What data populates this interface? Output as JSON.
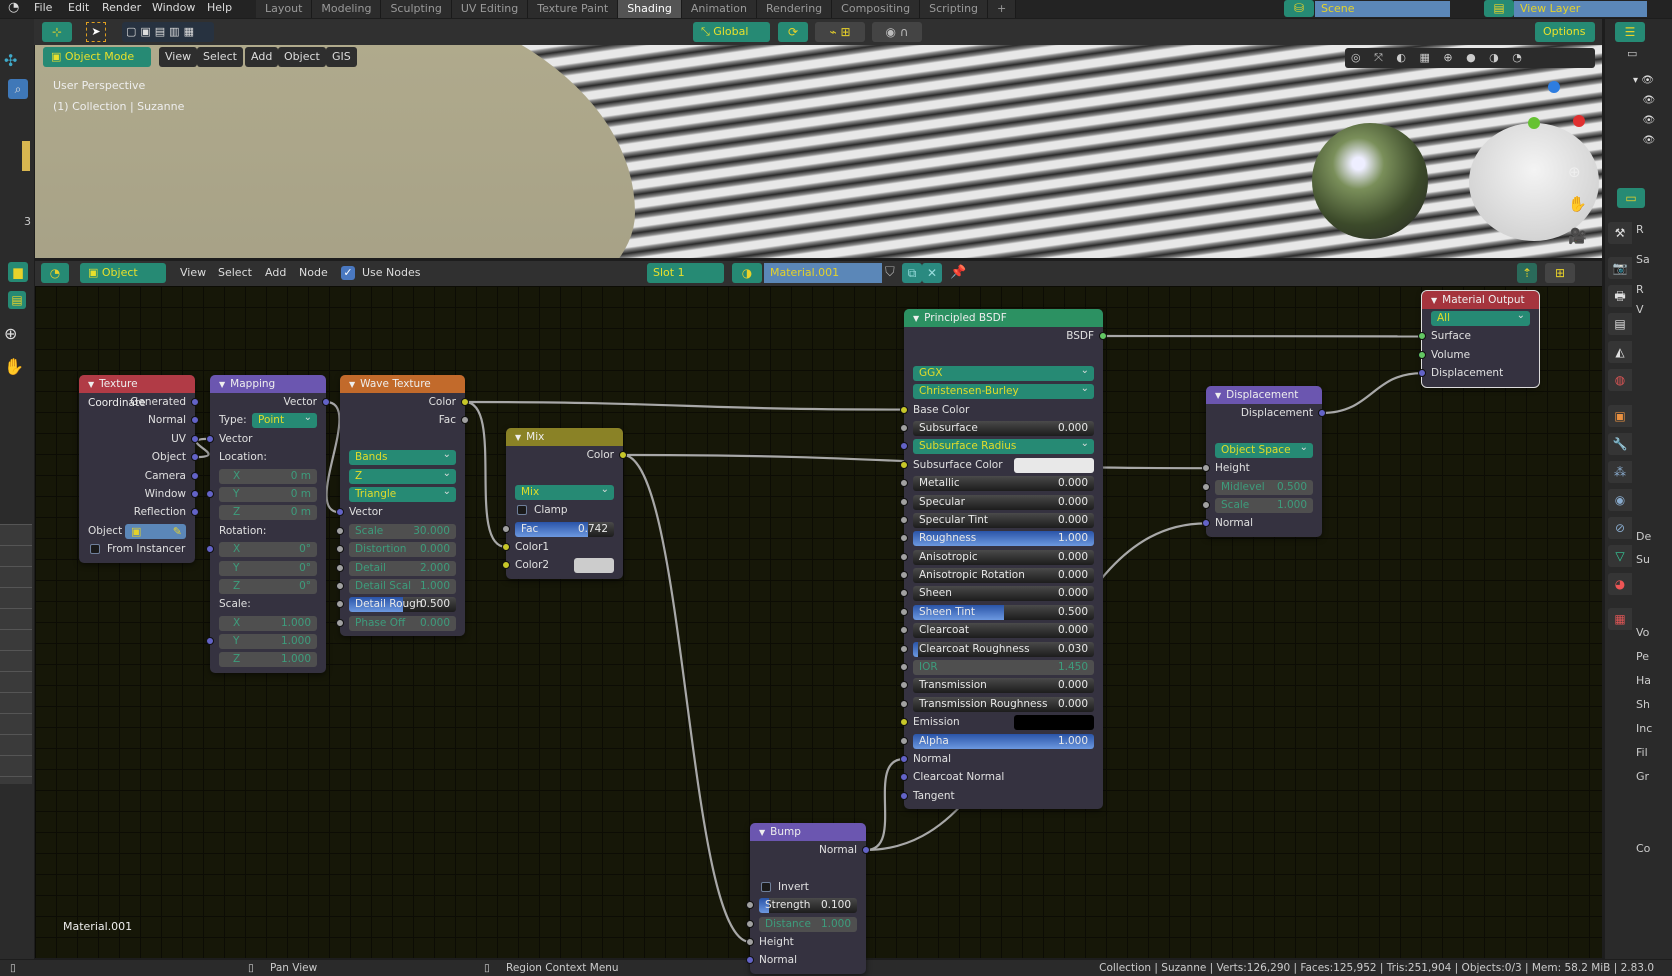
{
  "topbar": {
    "menus": [
      "File",
      "Edit",
      "Render",
      "Window",
      "Help"
    ],
    "tabs": [
      "Layout",
      "Modeling",
      "Sculpting",
      "UV Editing",
      "Texture Paint",
      "Shading",
      "Animation",
      "Rendering",
      "Compositing",
      "Scripting"
    ],
    "active_tab": "Shading",
    "add_tab": "+",
    "scene": "Scene",
    "view_layer": "View Layer"
  },
  "viewport_header": {
    "transform_orientation": "Global",
    "options": "Options",
    "mode": "Object Mode",
    "menus": [
      "View",
      "Select",
      "Add",
      "Object",
      "GIS"
    ]
  },
  "viewport": {
    "perspective": "User Perspective",
    "collection": "(1) Collection | Suzanne",
    "ruler_number": "3"
  },
  "node_header": {
    "object_dropdown": "Object",
    "menus": [
      "View",
      "Select",
      "Add",
      "Node"
    ],
    "use_nodes": "Use Nodes",
    "use_nodes_checked": true,
    "slot": "Slot 1",
    "material": "Material.001"
  },
  "canvas": {
    "material_label": "Material.001"
  },
  "colors": {
    "yellow": "#c7c729",
    "grey": "#a1a1a1",
    "blue": "#6363c7",
    "green": "#63c763",
    "header_texcoord": "#b13b46",
    "header_vector": "#6b56b0",
    "header_texture": "#c26a2b",
    "header_color": "#8a8226",
    "header_shader": "#2c9162",
    "header_output": "#a5343d"
  },
  "nodes": [
    {
      "id": "texcoord",
      "title": "Texture Coordinate",
      "head": "header_texcoord",
      "rows": [
        {
          "t": "out",
          "label": "Generated",
          "s": "blue"
        },
        {
          "t": "out",
          "label": "Normal",
          "s": "blue"
        },
        {
          "t": "out",
          "label": "UV",
          "s": "blue"
        },
        {
          "t": "out",
          "label": "Object",
          "s": "blue"
        },
        {
          "t": "out",
          "label": "Camera",
          "s": "blue"
        },
        {
          "t": "out",
          "label": "Window",
          "s": "blue"
        },
        {
          "t": "out",
          "label": "Reflection",
          "s": "blue"
        },
        {
          "t": "obj",
          "label": "Object"
        },
        {
          "t": "check",
          "label": "From Instancer"
        }
      ]
    },
    {
      "id": "mapping",
      "title": "Mapping",
      "head": "header_vector",
      "rows": [
        {
          "t": "out",
          "label": "Vector",
          "s": "blue"
        },
        {
          "t": "ddl",
          "label": "Type:",
          "value": "Point"
        },
        {
          "t": "in",
          "label": "Vector",
          "s": "blue"
        },
        {
          "t": "text",
          "label": "Location:"
        },
        {
          "t": "dis",
          "label": "X",
          "value": "0 m"
        },
        {
          "t": "dis",
          "label": "Y",
          "value": "0 m",
          "s": "blue"
        },
        {
          "t": "dis",
          "label": "Z",
          "value": "0 m"
        },
        {
          "t": "text",
          "label": "Rotation:"
        },
        {
          "t": "dis",
          "label": "X",
          "value": "0°",
          "s": "blue"
        },
        {
          "t": "dis",
          "label": "Y",
          "value": "0°"
        },
        {
          "t": "dis",
          "label": "Z",
          "value": "0°"
        },
        {
          "t": "text",
          "label": "Scale:"
        },
        {
          "t": "dis",
          "label": "X",
          "value": "1.000"
        },
        {
          "t": "dis",
          "label": "Y",
          "value": "1.000",
          "s": "blue"
        },
        {
          "t": "dis",
          "label": "Z",
          "value": "1.000"
        }
      ]
    },
    {
      "id": "wave",
      "title": "Wave Texture",
      "head": "header_texture",
      "rows": [
        {
          "t": "out",
          "label": "Color",
          "s": "yellow"
        },
        {
          "t": "out",
          "label": "Fac",
          "s": "grey"
        },
        {
          "t": "gap"
        },
        {
          "t": "dd",
          "value": "Bands"
        },
        {
          "t": "dd",
          "value": "Z"
        },
        {
          "t": "dd",
          "value": "Triangle"
        },
        {
          "t": "in",
          "label": "Vector",
          "s": "blue"
        },
        {
          "t": "dis",
          "label": "Scale",
          "value": "30.000",
          "s": "grey"
        },
        {
          "t": "dis",
          "label": "Distortion",
          "value": "0.000",
          "s": "grey"
        },
        {
          "t": "dis",
          "label": "Detail",
          "value": "2.000",
          "s": "grey"
        },
        {
          "t": "dis",
          "label": "Detail Scal",
          "value": "1.000",
          "s": "grey"
        },
        {
          "t": "sl",
          "label": "Detail Rough",
          "value": "0.500",
          "fill": 0.5,
          "s": "grey"
        },
        {
          "t": "dis",
          "label": "Phase Off",
          "value": "0.000",
          "s": "grey"
        }
      ]
    },
    {
      "id": "mix",
      "title": "Mix",
      "head": "header_color",
      "rows": [
        {
          "t": "out",
          "label": "Color",
          "s": "yellow"
        },
        {
          "t": "gap"
        },
        {
          "t": "dd",
          "value": "Mix"
        },
        {
          "t": "check",
          "label": "Clamp"
        },
        {
          "t": "sl",
          "label": "Fac",
          "value": "0.742",
          "fill": 0.742,
          "s": "grey"
        },
        {
          "t": "in",
          "label": "Color1",
          "s": "yellow"
        },
        {
          "t": "col",
          "label": "Color2",
          "swatch": "#cccccc",
          "s": "yellow"
        }
      ]
    },
    {
      "id": "principled",
      "title": "Principled BSDF",
      "head": "header_shader",
      "rows": [
        {
          "t": "out",
          "label": "BSDF",
          "s": "green"
        },
        {
          "t": "gap"
        },
        {
          "t": "dd",
          "value": "GGX"
        },
        {
          "t": "dd",
          "value": "Christensen-Burley"
        },
        {
          "t": "in",
          "label": "Base Color",
          "s": "yellow"
        },
        {
          "t": "sl",
          "label": "Subsurface",
          "value": "0.000",
          "fill": 0,
          "s": "grey"
        },
        {
          "t": "dd",
          "value": "Subsurface Radius",
          "s": "blue"
        },
        {
          "t": "col",
          "label": "Subsurface Color",
          "swatch": "#e8e8e8",
          "s": "yellow"
        },
        {
          "t": "sl",
          "label": "Metallic",
          "value": "0.000",
          "fill": 0,
          "s": "grey"
        },
        {
          "t": "sl",
          "label": "Specular",
          "value": "0.000",
          "fill": 0,
          "s": "grey"
        },
        {
          "t": "sl",
          "label": "Specular Tint",
          "value": "0.000",
          "fill": 0,
          "s": "grey"
        },
        {
          "t": "sl",
          "label": "Roughness",
          "value": "1.000",
          "fill": 1,
          "s": "grey"
        },
        {
          "t": "sl",
          "label": "Anisotropic",
          "value": "0.000",
          "fill": 0,
          "s": "grey"
        },
        {
          "t": "sl",
          "label": "Anisotropic Rotation",
          "value": "0.000",
          "fill": 0,
          "s": "grey"
        },
        {
          "t": "sl",
          "label": "Sheen",
          "value": "0.000",
          "fill": 0,
          "s": "grey"
        },
        {
          "t": "sl",
          "label": "Sheen Tint",
          "value": "0.500",
          "fill": 0.5,
          "s": "grey"
        },
        {
          "t": "sl",
          "label": "Clearcoat",
          "value": "0.000",
          "fill": 0,
          "s": "grey"
        },
        {
          "t": "sl",
          "label": "Clearcoat Roughness",
          "value": "0.030",
          "fill": 0.03,
          "s": "grey"
        },
        {
          "t": "dis",
          "label": "IOR",
          "value": "1.450",
          "s": "grey"
        },
        {
          "t": "sl",
          "label": "Transmission",
          "value": "0.000",
          "fill": 0,
          "s": "grey"
        },
        {
          "t": "sl",
          "label": "Transmission Roughness",
          "value": "0.000",
          "fill": 0,
          "s": "grey"
        },
        {
          "t": "col",
          "label": "Emission",
          "swatch": "#000000",
          "s": "yellow"
        },
        {
          "t": "sl",
          "label": "Alpha",
          "value": "1.000",
          "fill": 1,
          "s": "grey"
        },
        {
          "t": "in",
          "label": "Normal",
          "s": "blue"
        },
        {
          "t": "in",
          "label": "Clearcoat Normal",
          "s": "blue"
        },
        {
          "t": "in",
          "label": "Tangent",
          "s": "blue"
        }
      ]
    },
    {
      "id": "displacement",
      "title": "Displacement",
      "head": "header_vector",
      "rows": [
        {
          "t": "out",
          "label": "Displacement",
          "s": "blue"
        },
        {
          "t": "gap"
        },
        {
          "t": "dd",
          "value": "Object Space"
        },
        {
          "t": "in",
          "label": "Height",
          "s": "grey"
        },
        {
          "t": "dis",
          "label": "Midlevel",
          "value": "0.500",
          "s": "grey"
        },
        {
          "t": "dis",
          "label": "Scale",
          "value": "1.000",
          "s": "grey"
        },
        {
          "t": "in",
          "label": "Normal",
          "s": "blue"
        }
      ]
    },
    {
      "id": "output",
      "title": "Material Output",
      "head": "header_output",
      "rows": [
        {
          "t": "dd",
          "value": "All"
        },
        {
          "t": "in",
          "label": "Surface",
          "s": "green"
        },
        {
          "t": "in",
          "label": "Volume",
          "s": "green"
        },
        {
          "t": "in",
          "label": "Displacement",
          "s": "blue"
        }
      ]
    },
    {
      "id": "bump",
      "title": "Bump",
      "head": "header_vector",
      "rows": [
        {
          "t": "out",
          "label": "Normal",
          "s": "blue"
        },
        {
          "t": "gap"
        },
        {
          "t": "check",
          "label": "Invert"
        },
        {
          "t": "sl",
          "label": "Strength",
          "value": "0.100",
          "fill": 0.1,
          "s": "grey"
        },
        {
          "t": "dis",
          "label": "Distance",
          "value": "1.000",
          "s": "grey"
        },
        {
          "t": "in",
          "label": "Height",
          "s": "grey"
        },
        {
          "t": "in",
          "label": "Normal",
          "s": "blue"
        }
      ]
    }
  ],
  "links": [
    {
      "from": [
        "texcoord",
        "Object"
      ],
      "to": [
        "mapping",
        "Vector"
      ]
    },
    {
      "from": [
        "mapping",
        "Vector"
      ],
      "to": [
        "wave",
        "Vector"
      ]
    },
    {
      "from": [
        "wave",
        "Color"
      ],
      "to": [
        "principled",
        "Base Color"
      ]
    },
    {
      "from": [
        "wave",
        "Color"
      ],
      "to": [
        "mix",
        "Color1"
      ]
    },
    {
      "from": [
        "mix",
        "Color"
      ],
      "to": [
        "displacement",
        "Height"
      ]
    },
    {
      "from": [
        "mix",
        "Color"
      ],
      "to": [
        "bump",
        "Height"
      ]
    },
    {
      "from": [
        "bump",
        "Normal"
      ],
      "to": [
        "principled",
        "Normal"
      ]
    },
    {
      "from": [
        "bump",
        "Normal"
      ],
      "to": [
        "displacement",
        "Normal"
      ]
    },
    {
      "from": [
        "principled",
        "BSDF"
      ],
      "to": [
        "output",
        "Surface"
      ]
    },
    {
      "from": [
        "displacement",
        "Displacement"
      ],
      "to": [
        "output",
        "Displacement"
      ]
    }
  ],
  "properties": {
    "labels": [
      "R",
      "Sa",
      "R",
      "V",
      "De",
      "Su",
      "Vo",
      "Pe",
      "Ha",
      "Sh",
      "Inc",
      "Fil",
      "Gr",
      "Co"
    ]
  },
  "status": {
    "left_hint": "Pan View",
    "mid_hint": "Region Context Menu",
    "stats": "Collection | Suzanne | Verts:126,290 | Faces:125,952 | Tris:251,904 | Objects:0/3 | Mem: 58.2 MiB | 2.83.0"
  }
}
